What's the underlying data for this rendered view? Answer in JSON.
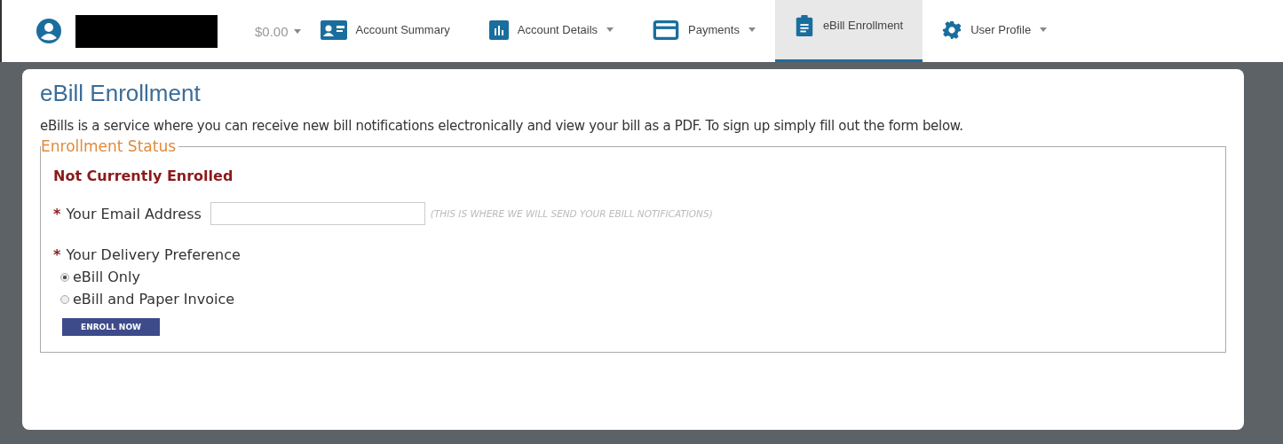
{
  "top_nav": {
    "balance": "$0.00",
    "balance_dropdown": true,
    "items": [
      {
        "label": "Account Summary",
        "dropdown": false,
        "selected": false
      },
      {
        "label": "Account Details",
        "dropdown": true,
        "selected": false
      },
      {
        "label": "Payments",
        "dropdown": true,
        "selected": false
      },
      {
        "label": "eBill Enrollment",
        "dropdown": false,
        "selected": true
      },
      {
        "label": "User Profile",
        "dropdown": true,
        "selected": false
      }
    ]
  },
  "page": {
    "title": "eBill Enrollment",
    "intro": "eBills is a service where you can receive new bill notifications electronically and view your bill as a PDF. To sign up simply fill out the form below.",
    "fieldset": {
      "legend": "Enrollment Status",
      "status": "Not Currently Enrolled",
      "required_mark": "*",
      "email": {
        "label": "Your Email Address",
        "hint": "(THIS IS WHERE WE WILL SEND YOUR EBILL NOTIFICATIONS)"
      },
      "delivery": {
        "label": "Your Delivery Preference",
        "options": [
          {
            "label": "eBill Only",
            "selected": true
          },
          {
            "label": "eBill and Paper Invoice",
            "selected": false
          }
        ]
      },
      "button": "ENROLL NOW"
    }
  }
}
